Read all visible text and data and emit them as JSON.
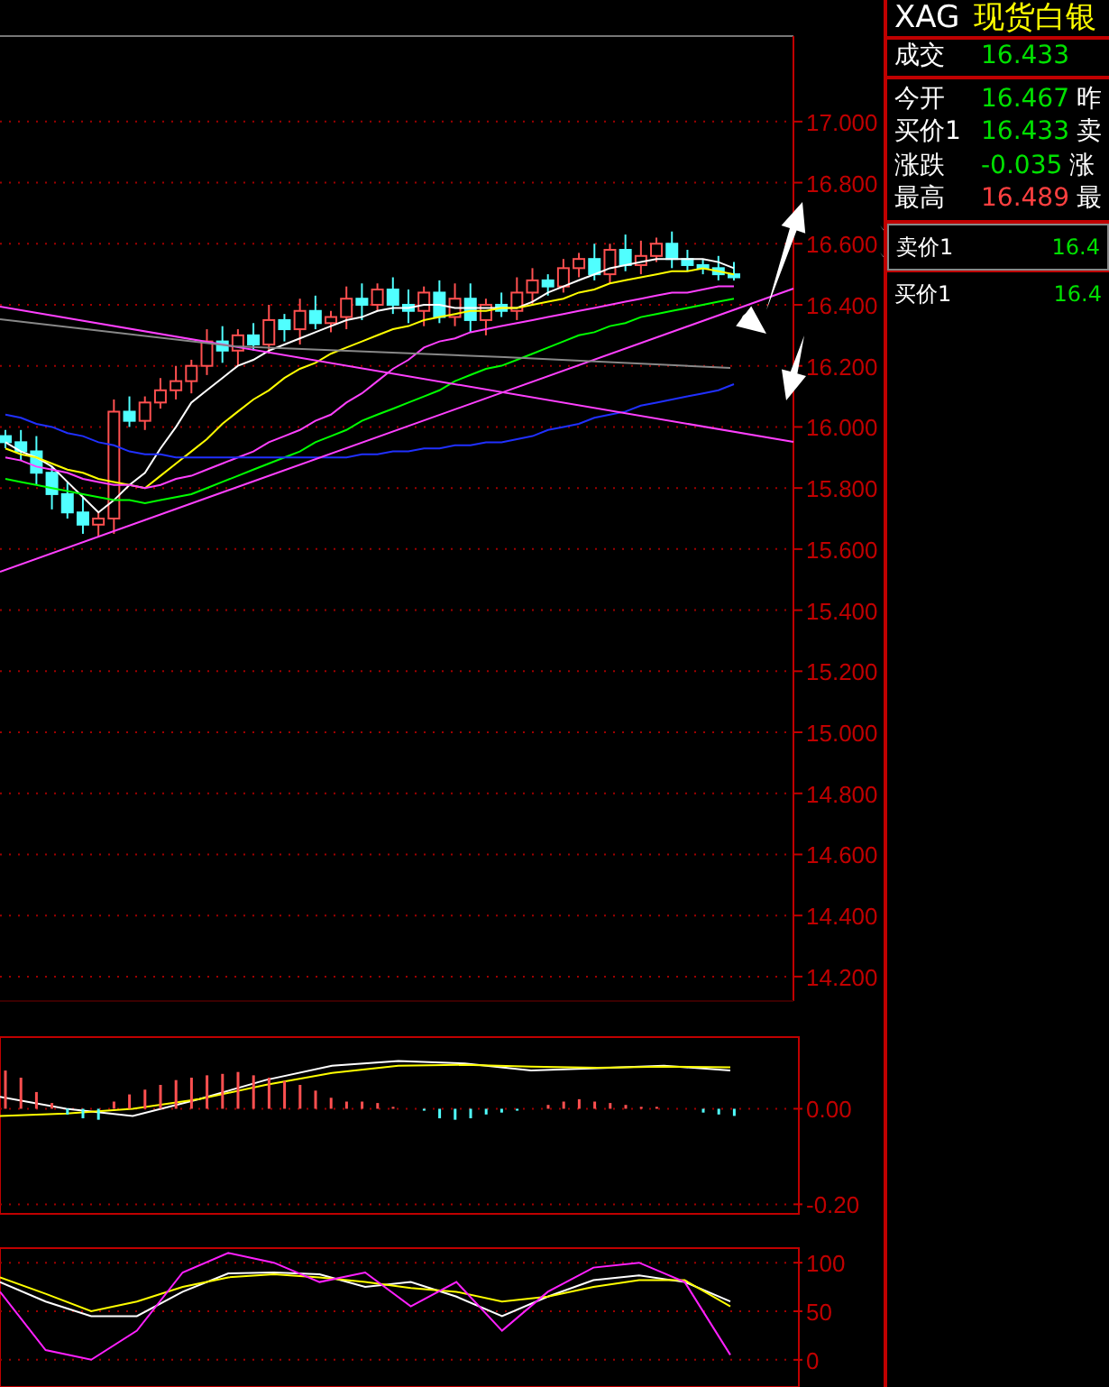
{
  "quote_panel": {
    "symbol": "XAG",
    "name": "现货白银",
    "rows": [
      {
        "label": "成交",
        "value": "16.433",
        "color": "#00e000"
      },
      {
        "label": "今开",
        "value": "16.467",
        "color": "#00e000",
        "label_2": "昨"
      },
      {
        "label": "买价1",
        "value": "16.433",
        "color": "#00e000",
        "label_2": "卖"
      },
      {
        "label": "涨跌",
        "value": "-0.035",
        "color": "#00e000",
        "label_2": "涨"
      },
      {
        "label": "最高",
        "value": "16.489",
        "color": "#ff4040",
        "label_2": "最"
      }
    ],
    "order_book": [
      {
        "label": "卖价1",
        "value": "16.4",
        "selected": true
      },
      {
        "label": "买价1",
        "value": "16.4",
        "selected": false
      }
    ]
  },
  "price_chart": {
    "chart_data": {
      "type": "candlestick",
      "ylim": [
        14.12,
        17.28
      ],
      "grid": true,
      "yticks": [
        {
          "value": 17.0,
          "label": "17.000"
        },
        {
          "value": 16.8,
          "label": "16.800"
        },
        {
          "value": 16.6,
          "label": "16.600"
        },
        {
          "value": 16.4,
          "label": "16.400"
        },
        {
          "value": 16.2,
          "label": "16.200"
        },
        {
          "value": 16.0,
          "label": "16.000"
        },
        {
          "value": 15.8,
          "label": "15.800"
        },
        {
          "value": 15.6,
          "label": "15.600"
        },
        {
          "value": 15.4,
          "label": "15.400"
        },
        {
          "value": 15.2,
          "label": "15.200"
        },
        {
          "value": 15.0,
          "label": "15.000"
        },
        {
          "value": 14.8,
          "label": "14.800"
        },
        {
          "value": 14.6,
          "label": "14.600"
        },
        {
          "value": 14.4,
          "label": "14.400"
        },
        {
          "value": 14.2,
          "label": "14.200"
        }
      ],
      "ohlc": [
        [
          15.97,
          15.99,
          15.93,
          15.95
        ],
        [
          15.95,
          15.99,
          15.89,
          15.92
        ],
        [
          15.92,
          15.97,
          15.81,
          15.85
        ],
        [
          15.85,
          15.87,
          15.73,
          15.78
        ],
        [
          15.78,
          15.82,
          15.7,
          15.72
        ],
        [
          15.72,
          15.77,
          15.65,
          15.68
        ],
        [
          15.68,
          15.72,
          15.64,
          15.7
        ],
        [
          15.7,
          16.09,
          15.65,
          16.05
        ],
        [
          16.05,
          16.1,
          16.0,
          16.02
        ],
        [
          16.02,
          16.1,
          15.99,
          16.08
        ],
        [
          16.08,
          16.16,
          16.06,
          16.12
        ],
        [
          16.12,
          16.2,
          16.09,
          16.15
        ],
        [
          16.15,
          16.22,
          16.11,
          16.2
        ],
        [
          16.2,
          16.32,
          16.17,
          16.28
        ],
        [
          16.28,
          16.33,
          16.21,
          16.25
        ],
        [
          16.25,
          16.32,
          16.2,
          16.3
        ],
        [
          16.3,
          16.34,
          16.25,
          16.27
        ],
        [
          16.27,
          16.4,
          16.24,
          16.35
        ],
        [
          16.35,
          16.37,
          16.28,
          16.32
        ],
        [
          16.32,
          16.42,
          16.27,
          16.38
        ],
        [
          16.38,
          16.43,
          16.32,
          16.34
        ],
        [
          16.34,
          16.38,
          16.31,
          16.36
        ],
        [
          16.36,
          16.46,
          16.32,
          16.42
        ],
        [
          16.42,
          16.47,
          16.35,
          16.4
        ],
        [
          16.4,
          16.47,
          16.38,
          16.45
        ],
        [
          16.45,
          16.49,
          16.37,
          16.4
        ],
        [
          16.4,
          16.45,
          16.34,
          16.38
        ],
        [
          16.38,
          16.46,
          16.33,
          16.44
        ],
        [
          16.44,
          16.48,
          16.34,
          16.36
        ],
        [
          16.36,
          16.47,
          16.33,
          16.42
        ],
        [
          16.42,
          16.47,
          16.31,
          16.35
        ],
        [
          16.35,
          16.42,
          16.3,
          16.4
        ],
        [
          16.4,
          16.44,
          16.36,
          16.38
        ],
        [
          16.38,
          16.49,
          16.35,
          16.44
        ],
        [
          16.44,
          16.52,
          16.4,
          16.48
        ],
        [
          16.48,
          16.5,
          16.43,
          16.46
        ],
        [
          16.46,
          16.55,
          16.44,
          16.52
        ],
        [
          16.52,
          16.57,
          16.49,
          16.55
        ],
        [
          16.55,
          16.6,
          16.48,
          16.5
        ],
        [
          16.5,
          16.6,
          16.47,
          16.58
        ],
        [
          16.58,
          16.63,
          16.51,
          16.53
        ],
        [
          16.53,
          16.61,
          16.5,
          16.56
        ],
        [
          16.56,
          16.62,
          16.54,
          16.6
        ],
        [
          16.6,
          16.64,
          16.52,
          16.55
        ],
        [
          16.55,
          16.58,
          16.51,
          16.53
        ],
        [
          16.53,
          16.55,
          16.5,
          16.52
        ],
        [
          16.52,
          16.56,
          16.48,
          16.5
        ],
        [
          16.5,
          16.54,
          16.48,
          16.49
        ]
      ]
    }
  },
  "moving_averages": {
    "chart_data": {
      "type": "line",
      "ylim": [
        14.12,
        17.28
      ],
      "series": [
        {
          "color": "#ffffff",
          "values": [
            15.95,
            15.92,
            15.9,
            15.87,
            15.82,
            15.77,
            15.72,
            15.76,
            15.81,
            15.85,
            15.93,
            16.0,
            16.08,
            16.12,
            16.16,
            16.2,
            16.22,
            16.25,
            16.27,
            16.29,
            16.31,
            16.33,
            16.35,
            16.36,
            16.38,
            16.39,
            16.39,
            16.4,
            16.4,
            16.39,
            16.39,
            16.39,
            16.39,
            16.39,
            16.41,
            16.44,
            16.46,
            16.48,
            16.5,
            16.52,
            16.53,
            16.54,
            16.55,
            16.55,
            16.55,
            16.55,
            16.54,
            16.52
          ]
        },
        {
          "color": "#ffff00",
          "values": [
            15.93,
            15.91,
            15.9,
            15.88,
            15.86,
            15.85,
            15.83,
            15.82,
            15.81,
            15.8,
            15.84,
            15.88,
            15.92,
            15.96,
            16.01,
            16.05,
            16.09,
            16.12,
            16.16,
            16.19,
            16.21,
            16.24,
            16.26,
            16.28,
            16.3,
            16.32,
            16.33,
            16.35,
            16.36,
            16.37,
            16.38,
            16.38,
            16.39,
            16.39,
            16.4,
            16.41,
            16.42,
            16.44,
            16.45,
            16.47,
            16.48,
            16.49,
            16.5,
            16.51,
            16.51,
            16.52,
            16.51,
            16.5
          ]
        },
        {
          "color": "#ff40ff",
          "values": [
            15.9,
            15.89,
            15.87,
            15.86,
            15.85,
            15.83,
            15.82,
            15.81,
            15.81,
            15.8,
            15.81,
            15.83,
            15.84,
            15.86,
            15.88,
            15.9,
            15.92,
            15.95,
            15.97,
            15.99,
            16.02,
            16.04,
            16.08,
            16.11,
            16.15,
            16.19,
            16.22,
            16.26,
            16.28,
            16.29,
            16.31,
            16.32,
            16.33,
            16.34,
            16.35,
            16.36,
            16.37,
            16.38,
            16.39,
            16.4,
            16.41,
            16.42,
            16.43,
            16.44,
            16.44,
            16.45,
            16.46,
            16.46
          ]
        },
        {
          "color": "#00ff00",
          "values": [
            15.83,
            15.82,
            15.81,
            15.8,
            15.79,
            15.78,
            15.77,
            15.76,
            15.76,
            15.75,
            15.76,
            15.77,
            15.78,
            15.8,
            15.82,
            15.84,
            15.86,
            15.88,
            15.9,
            15.92,
            15.95,
            15.97,
            15.99,
            16.02,
            16.04,
            16.06,
            16.08,
            16.1,
            16.12,
            16.15,
            16.17,
            16.19,
            16.2,
            16.22,
            16.24,
            16.26,
            16.28,
            16.3,
            16.31,
            16.33,
            16.34,
            16.36,
            16.37,
            16.38,
            16.39,
            16.4,
            16.41,
            16.42
          ]
        },
        {
          "color": "#2030ff",
          "values": [
            16.04,
            16.03,
            16.01,
            16.0,
            15.98,
            15.97,
            15.95,
            15.94,
            15.92,
            15.91,
            15.91,
            15.9,
            15.9,
            15.9,
            15.9,
            15.9,
            15.9,
            15.9,
            15.9,
            15.9,
            15.9,
            15.9,
            15.9,
            15.91,
            15.91,
            15.92,
            15.92,
            15.93,
            15.93,
            15.94,
            15.94,
            15.95,
            15.95,
            15.96,
            15.97,
            15.99,
            16.0,
            16.01,
            16.03,
            16.04,
            16.05,
            16.07,
            16.08,
            16.09,
            16.1,
            16.11,
            16.12,
            16.14
          ]
        }
      ]
    }
  },
  "macd_chart": {
    "chart_data": {
      "type": "line",
      "ylim": [
        -0.22,
        0.15
      ],
      "grid": true,
      "yticks": [
        {
          "value": 0.0,
          "label": "0.00"
        },
        {
          "value": -0.2,
          "label": "-0.20"
        }
      ],
      "series": [
        {
          "color": "#ffffff",
          "values": [
            0.025,
            0.0,
            -0.015,
            0.02,
            0.06,
            0.09,
            0.1,
            0.095,
            0.08,
            0.085,
            0.09,
            0.08
          ]
        },
        {
          "color": "#ffff00",
          "values": [
            -0.015,
            -0.01,
            0.0,
            0.02,
            0.05,
            0.075,
            0.09,
            0.092,
            0.088,
            0.086,
            0.088,
            0.087
          ]
        }
      ]
    }
  },
  "kdj_chart": {
    "chart_data": {
      "type": "line",
      "ylim": [
        -28,
        115
      ],
      "grid": true,
      "yticks": [
        {
          "value": 100,
          "label": "100"
        },
        {
          "value": 50,
          "label": "50"
        },
        {
          "value": 0,
          "label": "0"
        }
      ],
      "series": [
        {
          "color": "#ffffff",
          "values": [
            80,
            60,
            45,
            45,
            70,
            89,
            90,
            88,
            75,
            80,
            65,
            45,
            65,
            82,
            87,
            80,
            60
          ]
        },
        {
          "color": "#ffff00",
          "values": [
            85,
            68,
            50,
            60,
            75,
            85,
            88,
            85,
            80,
            74,
            70,
            60,
            65,
            75,
            82,
            82,
            55
          ]
        },
        {
          "color": "#ff20ff",
          "values": [
            70,
            10,
            0,
            30,
            90,
            110,
            100,
            80,
            90,
            55,
            80,
            30,
            70,
            95,
            100,
            80,
            5
          ]
        }
      ]
    }
  }
}
